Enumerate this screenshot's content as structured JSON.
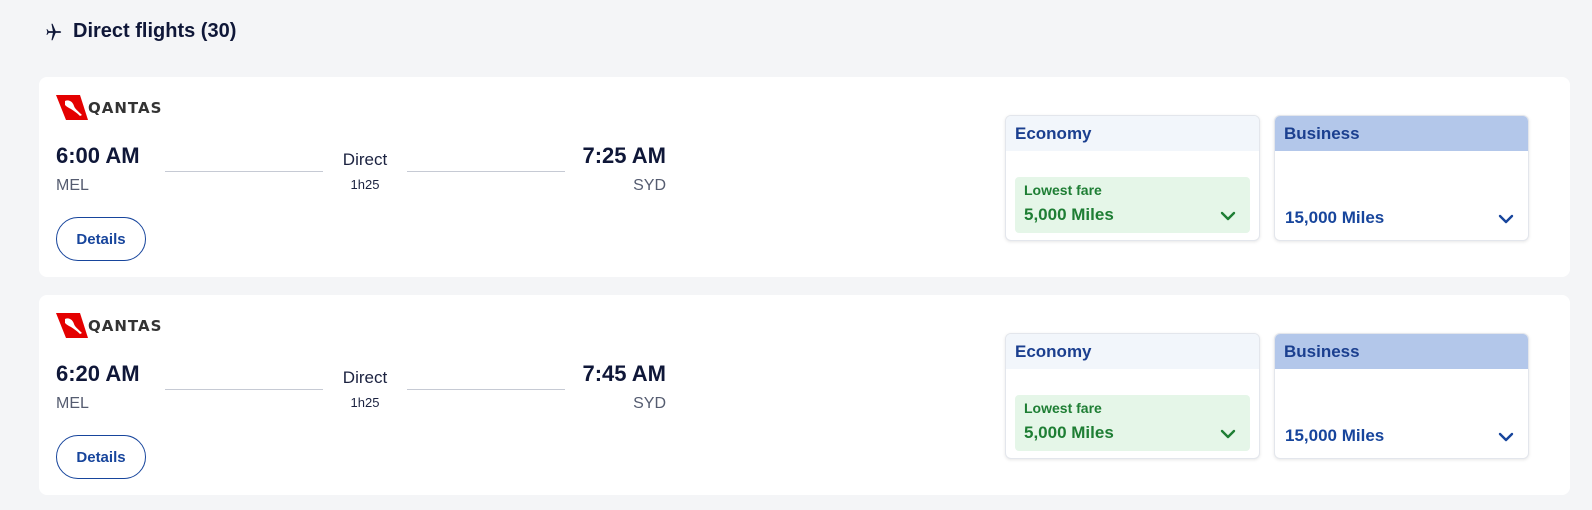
{
  "section": {
    "title": "Direct flights (30)",
    "icon": "plane-icon"
  },
  "colors": {
    "brand_red": "#e40000",
    "navy": "#0f1738",
    "link_blue": "#17459c",
    "green": "#1e7e34",
    "business_header": "#b3c7ea"
  },
  "flights": [
    {
      "airline": "QANTAS",
      "depart_time": "6:00 AM",
      "depart_code": "MEL",
      "arrive_time": "7:25 AM",
      "arrive_code": "SYD",
      "stops": "Direct",
      "duration": "1h25",
      "details_label": "Details",
      "economy": {
        "label": "Economy",
        "badge": "Lowest fare",
        "price": "5,000 Miles"
      },
      "business": {
        "label": "Business",
        "price": "15,000 Miles"
      }
    },
    {
      "airline": "QANTAS",
      "depart_time": "6:20 AM",
      "depart_code": "MEL",
      "arrive_time": "7:45 AM",
      "arrive_code": "SYD",
      "stops": "Direct",
      "duration": "1h25",
      "details_label": "Details",
      "economy": {
        "label": "Economy",
        "badge": "Lowest fare",
        "price": "5,000 Miles"
      },
      "business": {
        "label": "Business",
        "price": "15,000 Miles"
      }
    }
  ]
}
